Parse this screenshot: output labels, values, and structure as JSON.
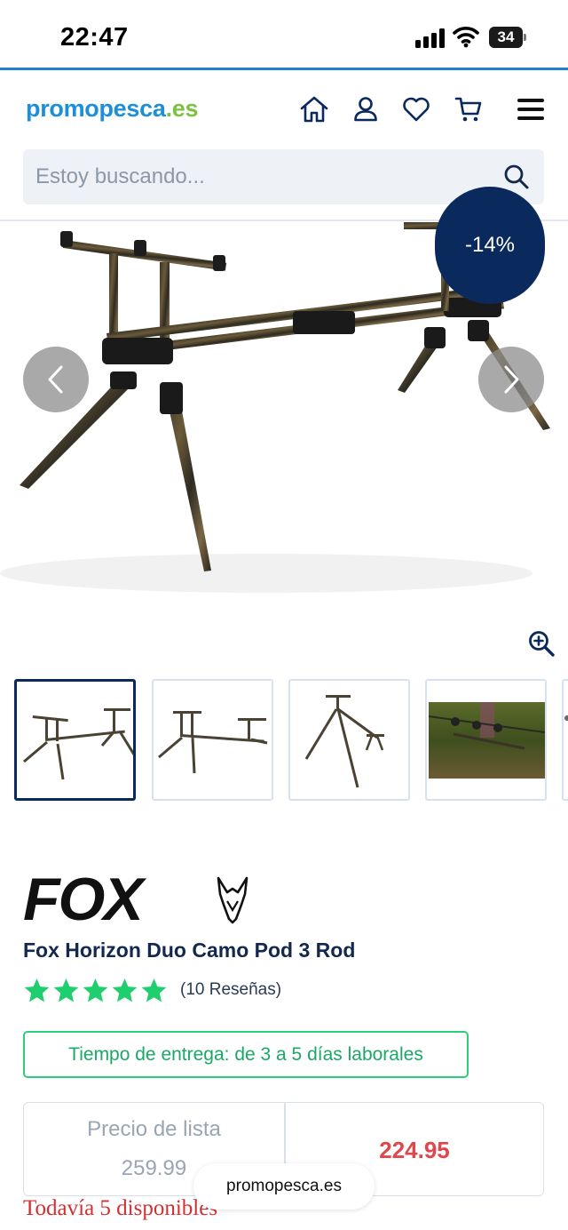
{
  "status_bar": {
    "time": "22:47",
    "battery": "34"
  },
  "header": {
    "logo_part1": "promopesca",
    "logo_part2": ".es",
    "icons": [
      "home-icon",
      "user-icon",
      "heart-icon",
      "cart-icon",
      "menu-icon"
    ]
  },
  "search": {
    "placeholder": "Estoy buscando..."
  },
  "gallery": {
    "discount_badge": "-14%"
  },
  "product": {
    "brand": "FOX",
    "title": "Fox Horizon Duo Camo Pod 3 Rod",
    "rating": 5,
    "reviews": "(10 Reseñas)",
    "delivery": "Tiempo de entrega: de 3 a 5 días laborales",
    "list_price_label": "Precio de lista",
    "list_price": "259.99",
    "sale_price": "224.95",
    "stock": "Todavía 5 disponibles"
  },
  "browser": {
    "url": "promopesca.es"
  },
  "colors": {
    "navy": "#0a2a5e",
    "accent_blue": "#1d8fd8",
    "accent_green": "#7cc242",
    "delivery_green": "#2bcf7a",
    "sale_red": "#e0474c",
    "star_green": "#1fcf6e"
  }
}
